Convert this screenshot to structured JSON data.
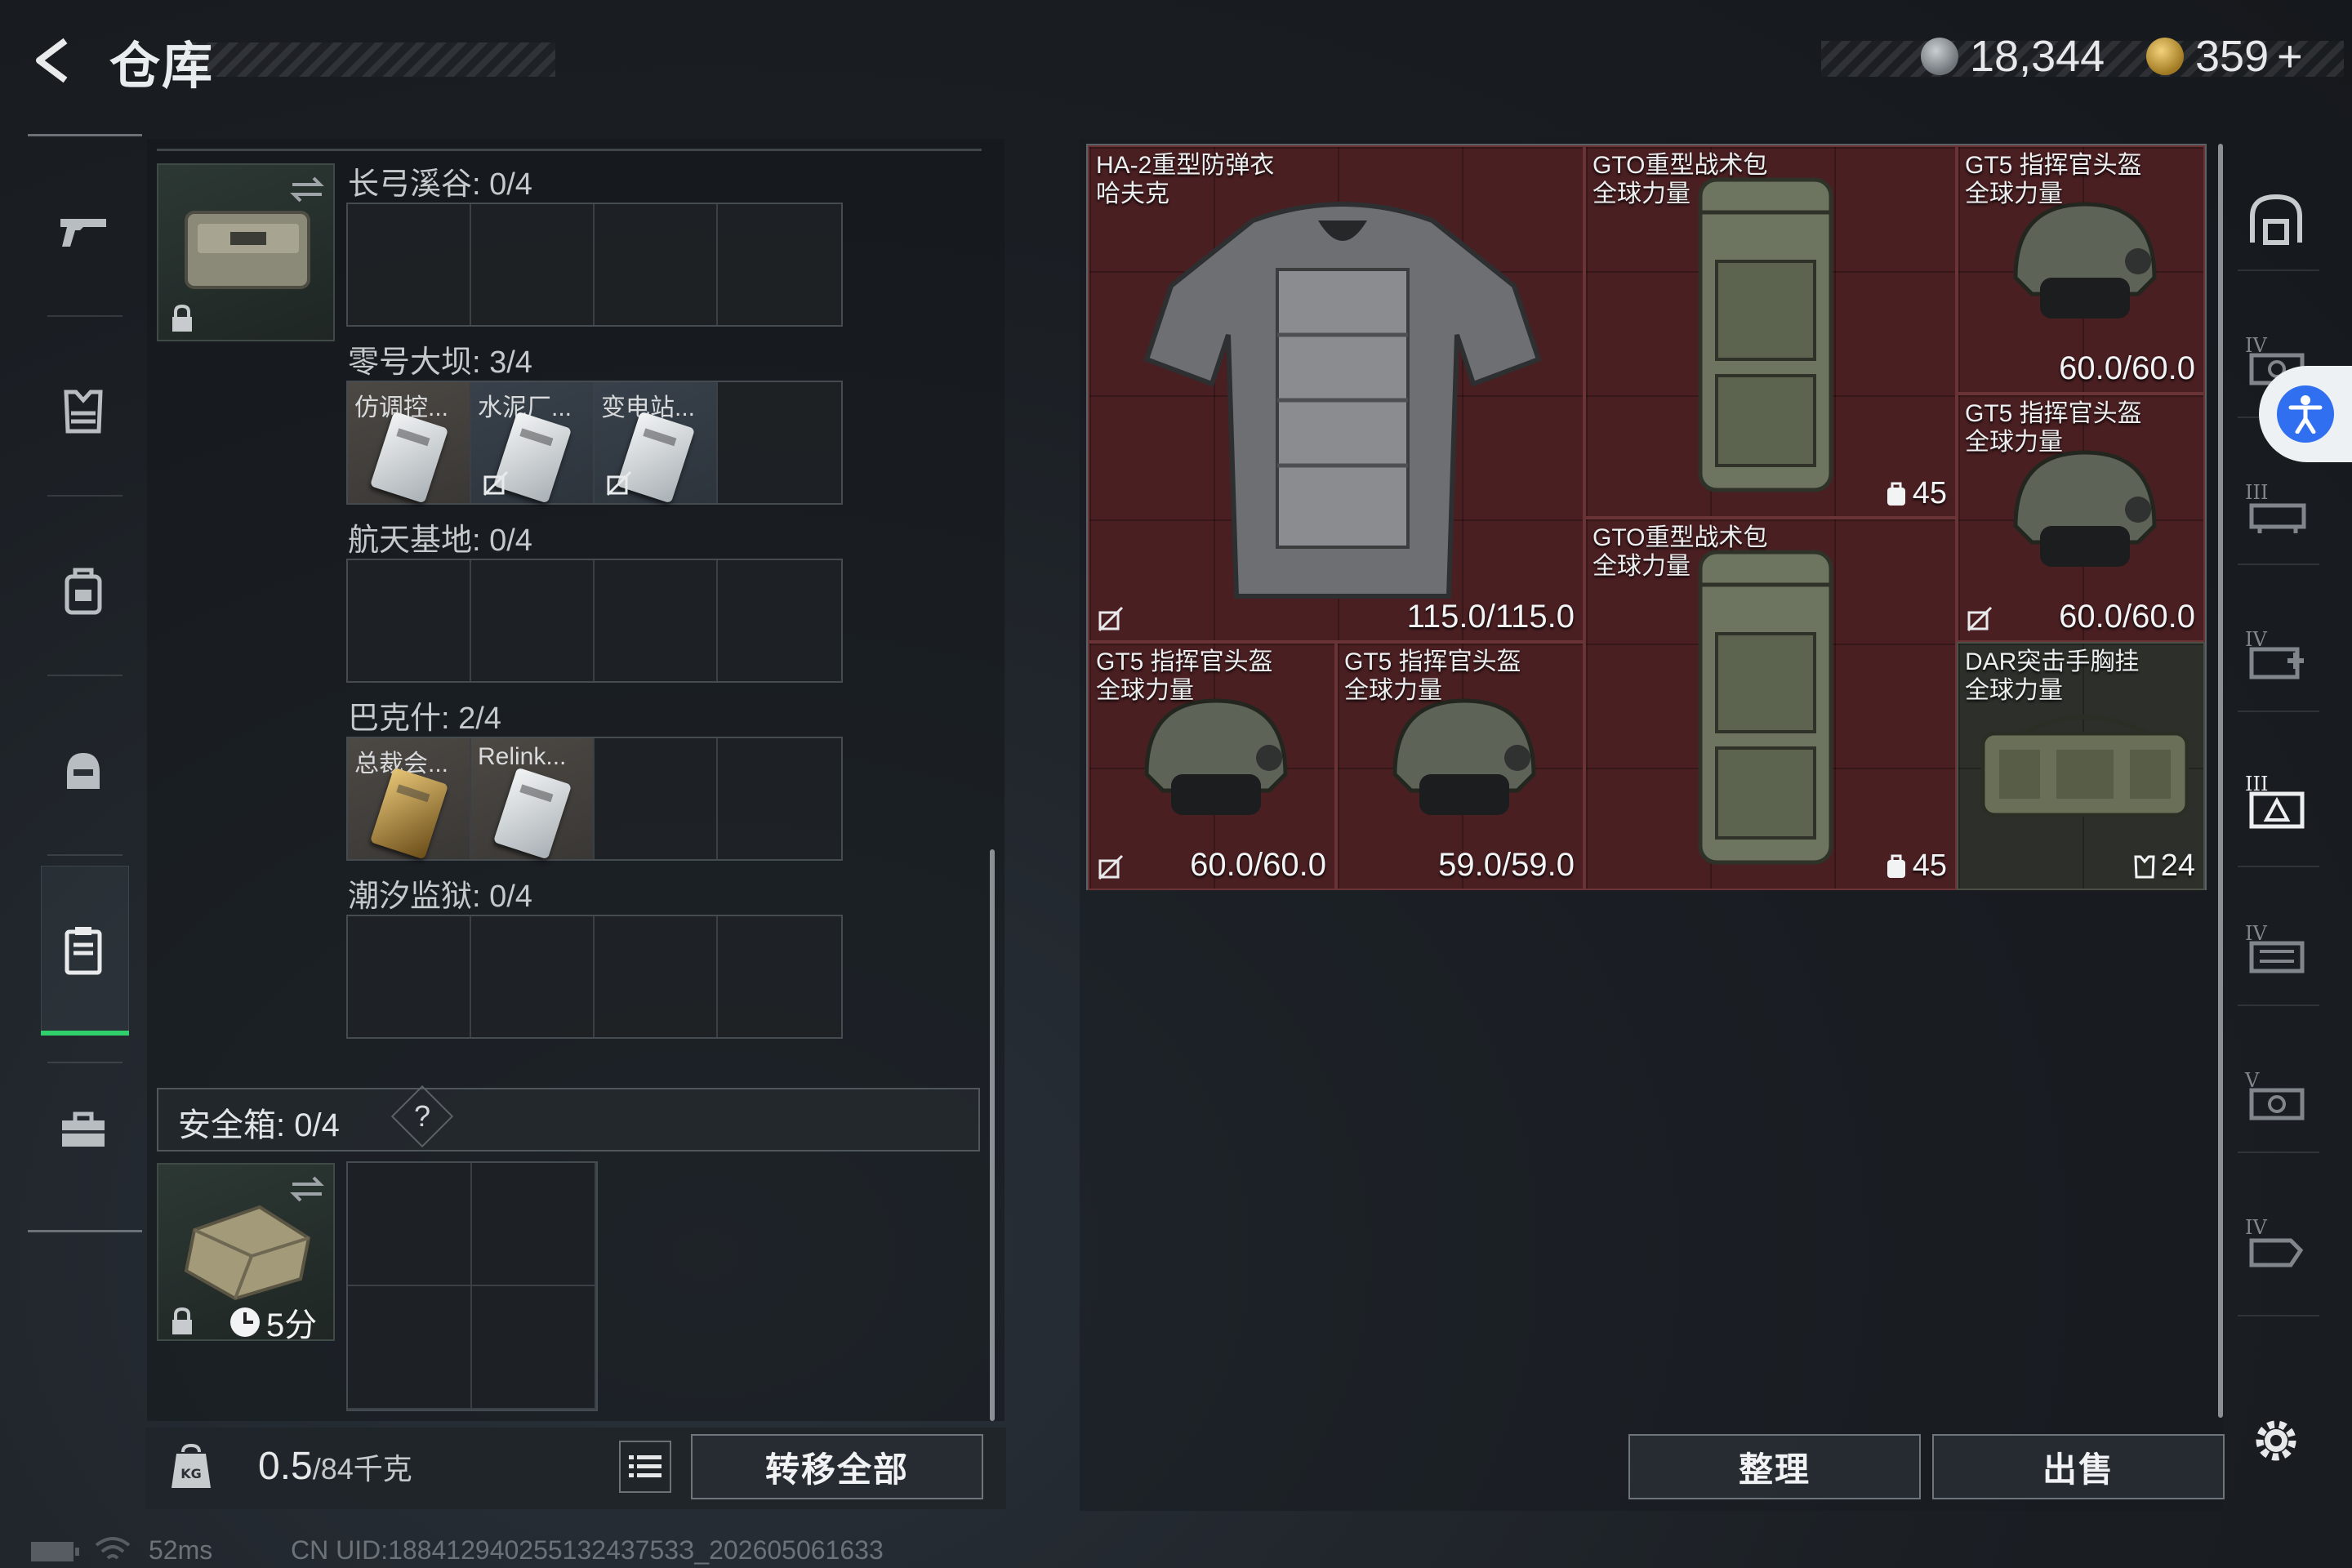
{
  "header": {
    "title": "仓库",
    "currency_silver": "18,344",
    "currency_gold": "359",
    "currency_plus": "+"
  },
  "sidebar_left": {
    "items": [
      "gun-icon",
      "armor-icon",
      "backpack-icon",
      "helmet-icon",
      "keycard-case-icon",
      "toolbox-icon"
    ],
    "active": "keycard-case-icon"
  },
  "key_sections": [
    {
      "label": "长弓溪谷: 0/4",
      "keys": []
    },
    {
      "label": "零号大坝: 3/4",
      "keys": [
        {
          "name": "仿调控...",
          "nosell": false
        },
        {
          "name": "水泥厂...",
          "nosell": true
        },
        {
          "name": "变电站...",
          "nosell": true
        }
      ]
    },
    {
      "label": "航天基地: 0/4",
      "keys": []
    },
    {
      "label": "巴克什: 2/4",
      "keys": [
        {
          "name": "总裁会...",
          "nosell": false
        },
        {
          "name": "Relink...",
          "nosell": false
        }
      ]
    },
    {
      "label": "潮汐监狱: 0/4",
      "keys": []
    }
  ],
  "safe_box": {
    "label": "安全箱: 0/4",
    "help": "?",
    "timer": "5分"
  },
  "bottom_left": {
    "weight_value": "0.5",
    "weight_unit": "/84千克",
    "transfer_all": "转移全部"
  },
  "storage_items": [
    {
      "name1": "HA-2重型防弹衣",
      "name2": "哈夫克",
      "durability": "115.0/115.0"
    },
    {
      "name1": "GTO重型战术包",
      "name2": "全球力量",
      "count": "45"
    },
    {
      "name1": "GT5 指挥官头盔",
      "name2": "全球力量",
      "durability": "60.0/60.0"
    },
    {
      "name1": "GT5 指挥官头盔",
      "name2": "全球力量",
      "durability": "60.0/60.0"
    },
    {
      "name1": "GTO重型战术包",
      "name2": "全球力量",
      "count": "45"
    },
    {
      "name1": "GT5 指挥官头盔",
      "name2": "全球力量",
      "durability": "60.0/60.0"
    },
    {
      "name1": "GT5 指挥官头盔",
      "name2": "全球力量",
      "durability": "59.0/59.0"
    },
    {
      "name1": "DAR突击手胸挂",
      "name2": "全球力量",
      "count": "24"
    }
  ],
  "bottom_right": {
    "sort": "整理",
    "sell": "出售"
  },
  "right_sidebar": {
    "tier_labels": [
      "IV",
      "III",
      "IV",
      "III",
      "IV",
      "V",
      "IV"
    ]
  },
  "status_bar": {
    "ping": "52ms",
    "uid": "CN UID:18841294025513243753З_202605061633"
  },
  "colors": {
    "accent_green": "#2fd06b",
    "item_red": "#4a1f22",
    "access_blue": "#2f6ff0"
  }
}
